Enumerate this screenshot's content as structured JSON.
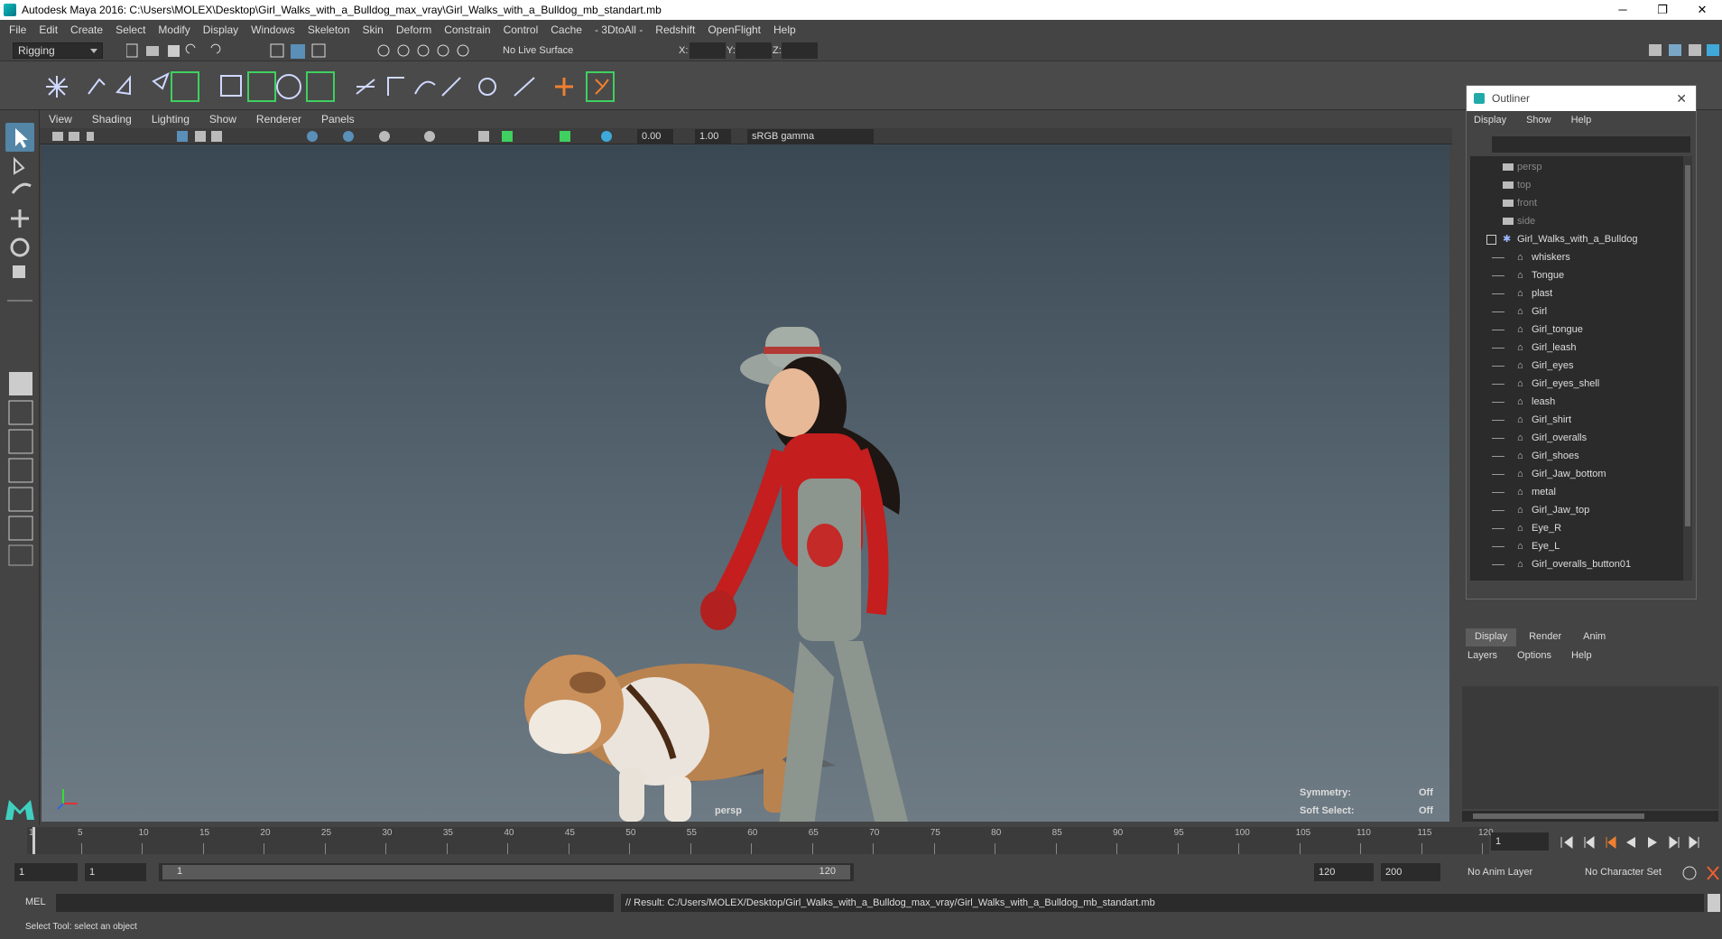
{
  "window": {
    "title": "Autodesk Maya 2016: C:\\Users\\MOLEX\\Desktop\\Girl_Walks_with_a_Bulldog_max_vray\\Girl_Walks_with_a_Bulldog_mb_standart.mb",
    "minimize": "─",
    "restore": "❐",
    "close": "✕"
  },
  "menu": [
    "File",
    "Edit",
    "Create",
    "Select",
    "Modify",
    "Display",
    "Windows",
    "Skeleton",
    "Skin",
    "Deform",
    "Constrain",
    "Control",
    "Cache",
    "- 3DtoAll -",
    "Redshift",
    "OpenFlight",
    "Help"
  ],
  "status": {
    "mode": "Rigging",
    "live_surface": "No Live Surface",
    "x_label": "X:",
    "y_label": "Y:",
    "z_label": "Z:"
  },
  "viewport": {
    "menu": [
      "View",
      "Shading",
      "Lighting",
      "Show",
      "Renderer",
      "Panels"
    ],
    "exposure": "0.00",
    "gamma": "1.00",
    "color_space": "sRGB gamma",
    "camera": "persp",
    "symmetry_label": "Symmetry:",
    "symmetry_value": "Off",
    "soft_select_label": "Soft Select:",
    "soft_select_value": "Off"
  },
  "outliner": {
    "title": "Outliner",
    "menu": [
      "Display",
      "Show",
      "Help"
    ],
    "cameras": [
      "persp",
      "top",
      "front",
      "side"
    ],
    "group": "Girl_Walks_with_a_Bulldog",
    "children": [
      "whiskers",
      "Tongue",
      "plast",
      "Girl",
      "Girl_tongue",
      "Girl_leash",
      "Girl_eyes",
      "Girl_eyes_shell",
      "leash",
      "Girl_shirt",
      "Girl_overalls",
      "Girl_shoes",
      "Girl_Jaw_bottom",
      "metal",
      "Girl_Jaw_top",
      "Eye_R",
      "Eye_L",
      "Girl_overalls_button01"
    ]
  },
  "channel": {
    "tabs": [
      "Display",
      "Render",
      "Anim"
    ],
    "menu": [
      "Layers",
      "Options",
      "Help"
    ]
  },
  "timeline": {
    "ticks": [
      1,
      5,
      10,
      15,
      20,
      25,
      30,
      35,
      40,
      45,
      50,
      55,
      60,
      65,
      70,
      75,
      80,
      85,
      90,
      95,
      100,
      105,
      110,
      115,
      120
    ],
    "current_frame": "1"
  },
  "range": {
    "start": "1",
    "inner_start": "1",
    "slider_start": "1",
    "slider_end": "120",
    "end": "120",
    "total_end": "200",
    "anim_layer": "No Anim Layer",
    "char_set": "No Character Set"
  },
  "command": {
    "lang": "MEL",
    "result": "// Result: C:/Users/MOLEX/Desktop/Girl_Walks_with_a_Bulldog_max_vray/Girl_Walks_with_a_Bulldog_mb_standart.mb"
  },
  "help": "Select Tool: select an object",
  "colors": {
    "accent": "#3fd0c0",
    "ui": "#444444",
    "viewport_top": "#3a4854",
    "viewport_bottom": "#6e7b84",
    "red": "#c41e1e"
  }
}
